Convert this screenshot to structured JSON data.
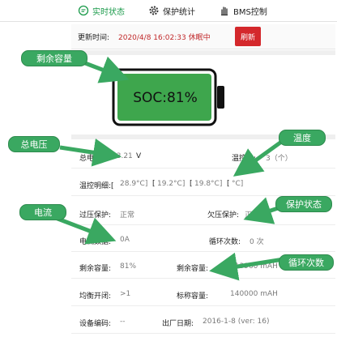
{
  "tabs": [
    {
      "label": "实时状态",
      "icon": "chat-icon"
    },
    {
      "label": "保护统计",
      "icon": "gear-icon"
    },
    {
      "label": "BMS控制",
      "icon": "hand-icon"
    }
  ],
  "update": {
    "label": "更新时间:",
    "value": "2020/4/8 16:02:33 休眠中",
    "refresh_label": "刷新"
  },
  "battery": {
    "soc_text": "SOC:81%",
    "soc_percent": 81,
    "fill_color": "#3ea64d"
  },
  "status": {
    "total_voltage": {
      "label": "总电压:",
      "value": "53.21",
      "unit": "V"
    },
    "temp_count": {
      "label": "温控数:",
      "value": "3（个）"
    },
    "temp_detail": {
      "label": "温控明细:[",
      "values": [
        "28.9°C]",
        "[",
        "19.2°C]",
        "[",
        "19.8°C]",
        "[",
        "°C]"
      ]
    },
    "over_voltage": {
      "label": "过压保护:",
      "value": "正常"
    },
    "under_voltage": {
      "label": "欠压保护:",
      "value": "正常"
    },
    "current": {
      "label": "电流数据:",
      "value": "0A"
    },
    "cycle_count": {
      "label": "循环次数:",
      "value": "0 次"
    },
    "remaining_capacity": {
      "label": "剩余容量:",
      "value": "81%"
    },
    "remaining_capacity_mah": {
      "label": "剩余容量:",
      "value": "113960 mAH"
    },
    "balance_switch": {
      "label": "均衡开闭:",
      "value": ">1"
    },
    "nominal_capacity": {
      "label": "标称容量:",
      "value": "140000 mAH"
    },
    "device_code": {
      "label": "设备编码:",
      "value": "--"
    },
    "manufacture_date": {
      "label": "出厂日期:",
      "value": "2016-1-8 (ver: 16)"
    }
  },
  "callouts": {
    "remaining_capacity": "剩余容量",
    "total_voltage": "总电压",
    "temperature": "温度",
    "current": "电流",
    "protection_status": "保护状态",
    "cycle_count": "循环次数"
  },
  "colors": {
    "accent": "#1a9a4a",
    "refresh": "#d4282c",
    "callout": "#3aa861",
    "time_text": "#c0282a"
  }
}
